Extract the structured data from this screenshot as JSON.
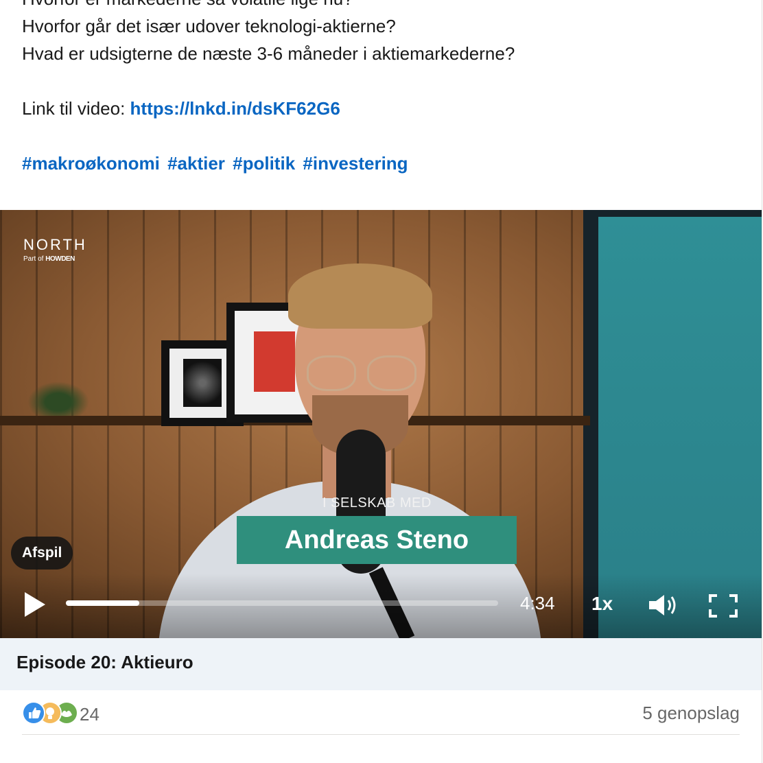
{
  "post": {
    "lines": [
      "Hvorfor er markederne så volatile lige nu?",
      "Hvorfor går det især udover teknologi-aktierne?",
      "Hvad er udsigterne de næste 3-6 måneder i aktiemarkederne?"
    ],
    "link_prefix": "Link til video: ",
    "link_text": "https://lnkd.in/dsKF62G6",
    "hashtags": [
      "#makroøkonomi",
      "#aktier",
      "#politik",
      "#investering"
    ]
  },
  "video": {
    "logo_main": "NORTH",
    "logo_sub_prefix": "Part of",
    "logo_sub_brand": "HOWDEN",
    "lower_third_sub": "I SELSKAB MED",
    "lower_third_name": "Andreas Steno",
    "play_pill_label": "Afspil",
    "duration": "4:34",
    "speed": "1x",
    "progress_fraction": 0.17,
    "icons": [
      "play-icon",
      "volume-icon",
      "fullscreen-icon"
    ]
  },
  "episode": {
    "title": "Episode 20: Aktieuro"
  },
  "social": {
    "reaction_icons": [
      "like-icon",
      "insightful-icon",
      "support-icon"
    ],
    "reaction_count": "24",
    "reposts": "5 genopslag"
  },
  "colors": {
    "link": "#0a66c2",
    "lower_third_bg": "#2f8f7d",
    "episode_bar_bg": "#eef3f8"
  }
}
